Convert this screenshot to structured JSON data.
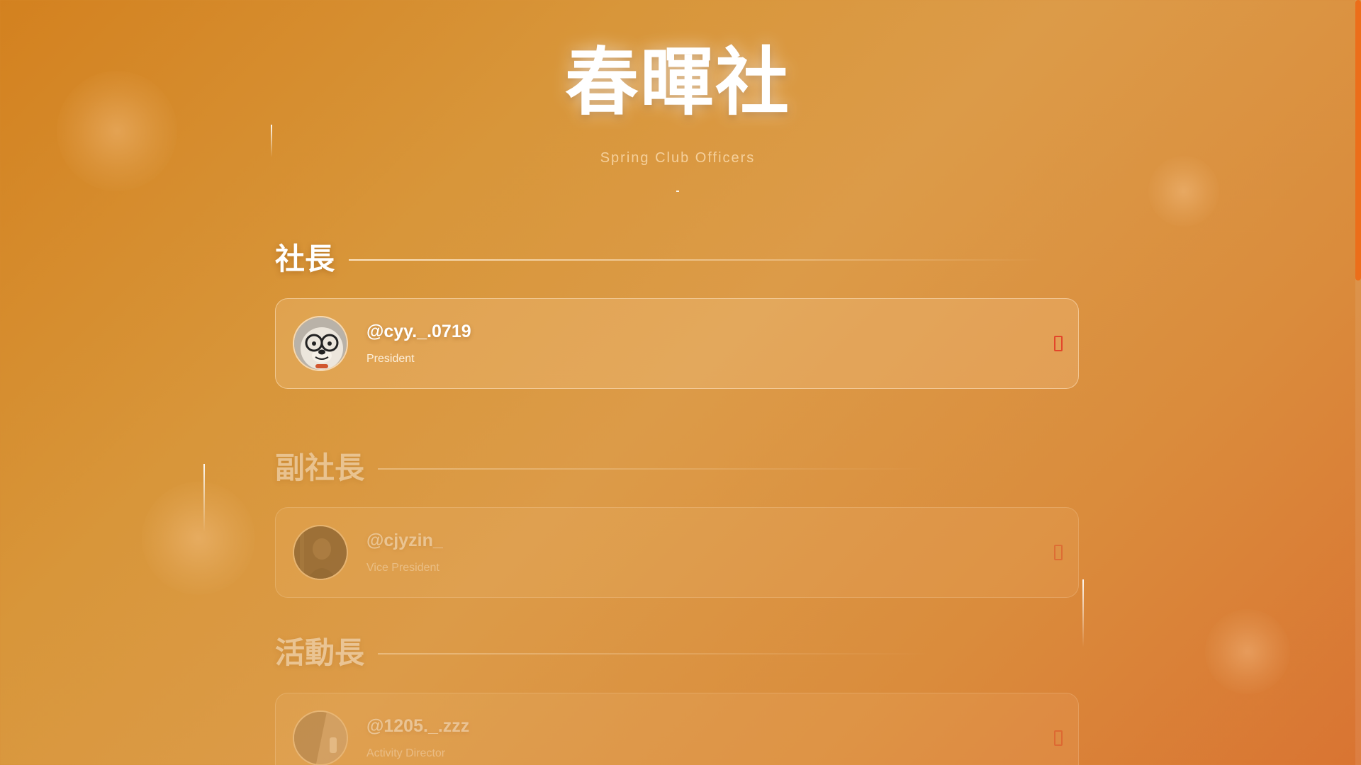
{
  "header": {
    "title": "春暉社",
    "subtitle": "Spring Club Officers"
  },
  "theme": {
    "accent": "#ec6e1a",
    "icon_color": "#e3462a",
    "text": "#ffffff"
  },
  "sections": [
    {
      "heading": "社長",
      "officers": [
        {
          "handle": "@cyy._.0719",
          "role": "President",
          "avatar": "glasses-dog-avatar",
          "link_icon": "instagram-icon"
        }
      ]
    },
    {
      "heading": "副社長",
      "officers": [
        {
          "handle": "@cjyzin_",
          "role": "Vice President",
          "avatar": "dark-photo-avatar",
          "link_icon": "instagram-icon"
        }
      ]
    },
    {
      "heading": "活動長",
      "officers": [
        {
          "handle": "@1205._.zzz",
          "role": "Activity Director",
          "avatar": "light-photo-avatar",
          "link_icon": "instagram-icon"
        }
      ]
    }
  ]
}
